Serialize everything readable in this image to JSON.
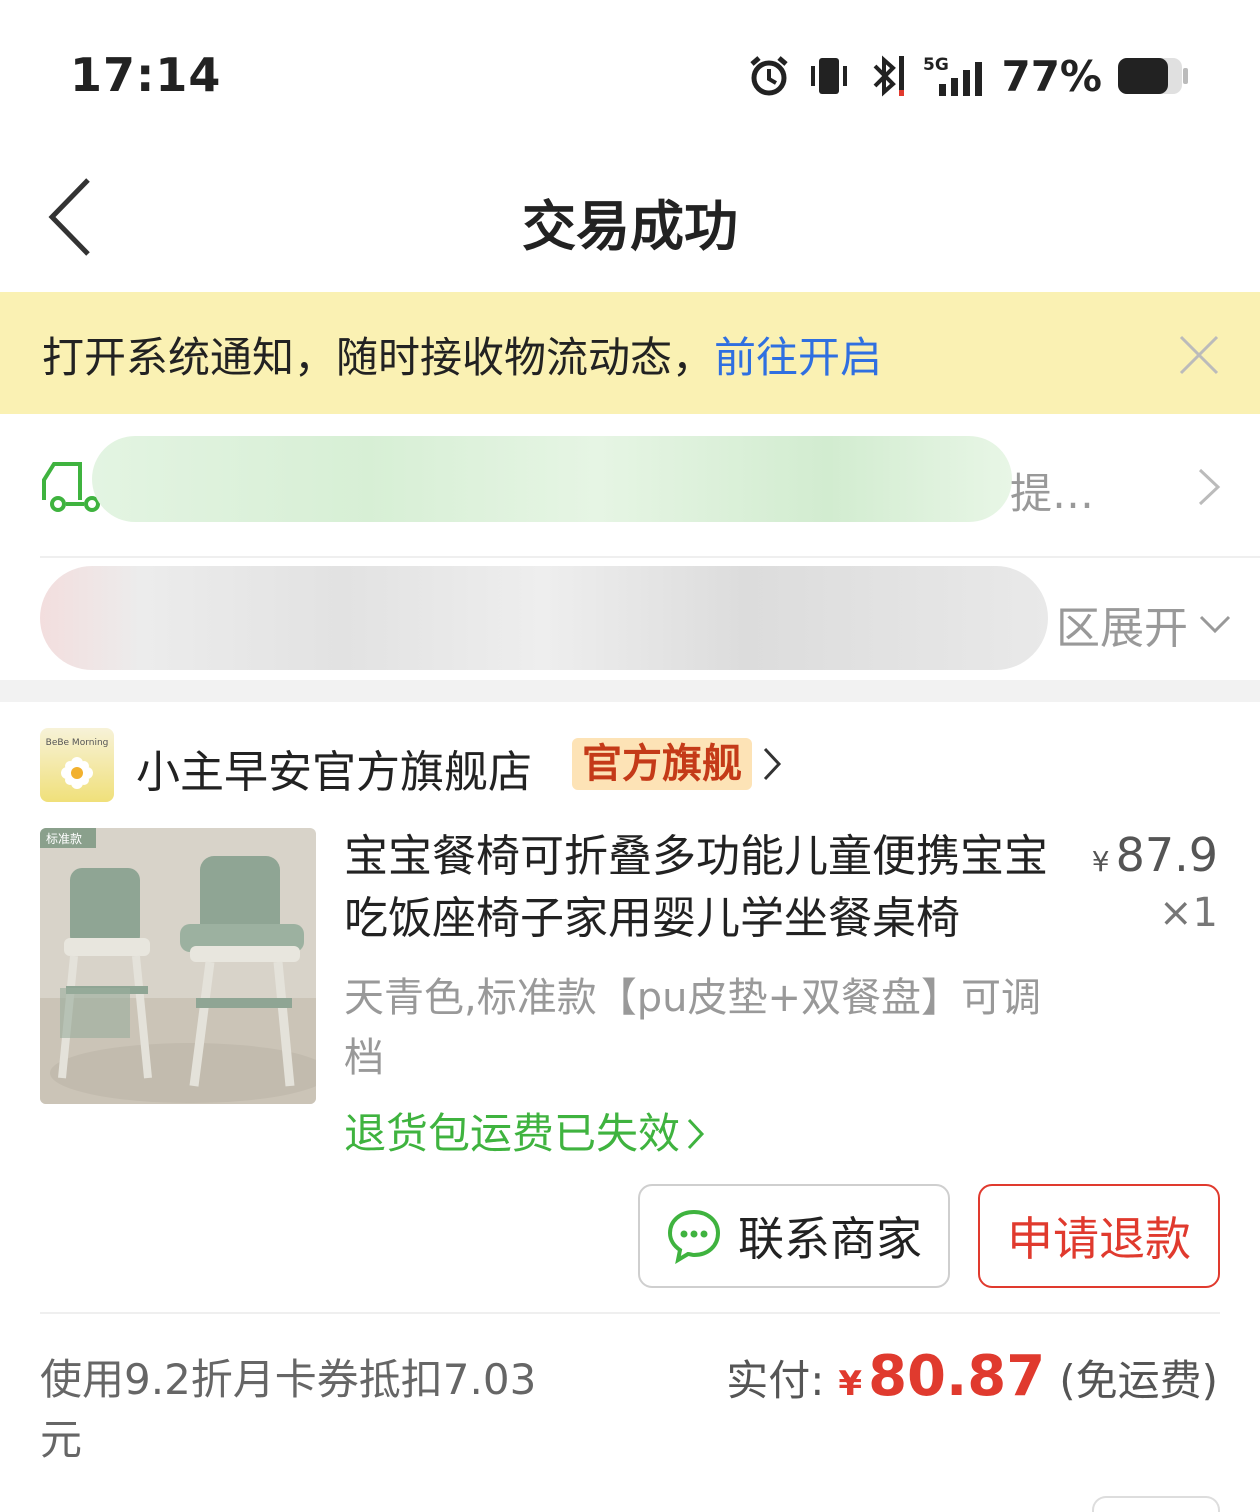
{
  "status_bar": {
    "time": "17:14",
    "network": "5G",
    "battery": "77%"
  },
  "nav": {
    "title": "交易成功"
  },
  "notice": {
    "text": "打开系统通知，随时接收物流动态，",
    "link": "前往开启"
  },
  "logistics": {
    "tail_text": "提…"
  },
  "address": {
    "tail_text": "区展开"
  },
  "store": {
    "name": "小主早安官方旗舰店",
    "badge": "官方旗舰",
    "logo_text": "BeBe Morning"
  },
  "product": {
    "title": "宝宝餐椅可折叠多功能儿童便携宝宝吃饭座椅子家用婴儿学坐餐桌椅",
    "price_symbol": "¥",
    "price": "87.9",
    "quantity": "×1",
    "sku": "天青色,标准款【pu皮垫+双餐盘】可调档",
    "return_note": "退货包运费已失效",
    "image_tag": "标准款"
  },
  "actions": {
    "contact_label": "联系商家",
    "refund_label": "申请退款"
  },
  "summary": {
    "discount_text": "使用9.2折月卡券抵扣7.03元",
    "paid_label": "实付:",
    "paid_symbol": "¥",
    "paid_amount": "80.87",
    "freight_note": "(免运费)"
  },
  "colors": {
    "accent_red": "#e03a2e",
    "link_blue": "#2f6fe0",
    "notice_bg": "#faf1b3",
    "green": "#3fb33f"
  }
}
